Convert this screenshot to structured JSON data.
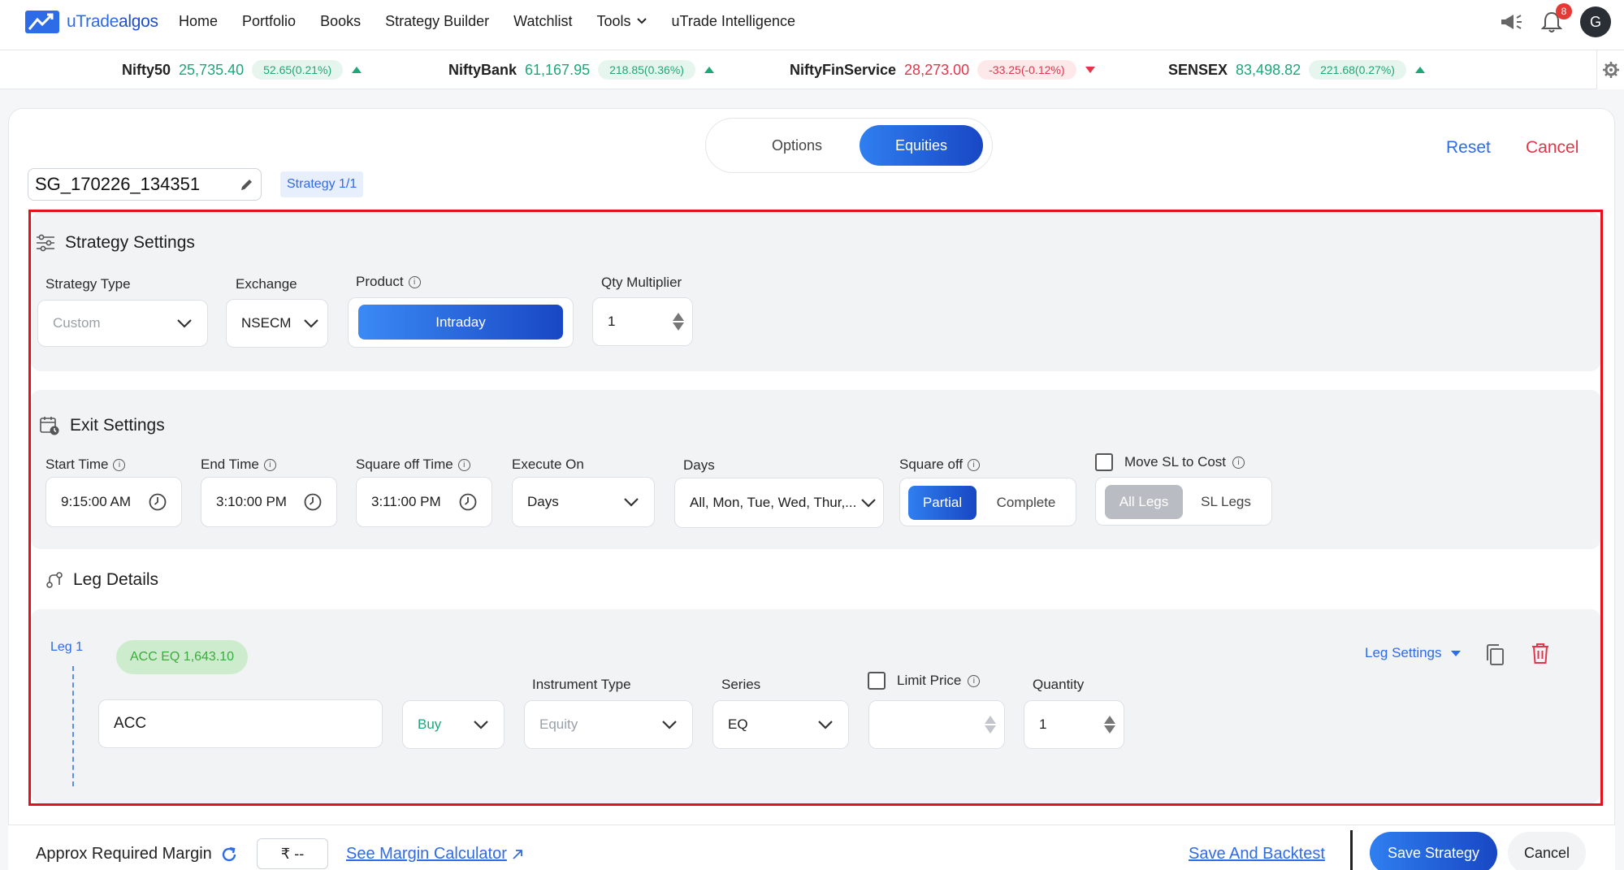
{
  "brand": {
    "name_part1": "uTrade",
    "name_part2": "algos"
  },
  "nav": {
    "items": [
      "Home",
      "Portfolio",
      "Books",
      "Strategy Builder",
      "Watchlist",
      "Tools",
      "uTrade Intelligence"
    ],
    "notification_count": "8",
    "avatar_initial": "G"
  },
  "ticker": [
    {
      "name": "Nifty50",
      "value": "25,735.40",
      "change": "52.65(0.21%)",
      "direction": "up"
    },
    {
      "name": "NiftyBank",
      "value": "61,167.95",
      "change": "218.85(0.36%)",
      "direction": "up"
    },
    {
      "name": "NiftyFinService",
      "value": "28,273.00",
      "change": "-33.25(-0.12%)",
      "direction": "down"
    },
    {
      "name": "SENSEX",
      "value": "83,498.82",
      "change": "221.68(0.27%)",
      "direction": "up"
    }
  ],
  "mode_toggle": {
    "options": [
      "Options",
      "Equities"
    ],
    "selected": "Equities"
  },
  "header_actions": {
    "reset": "Reset",
    "cancel": "Cancel"
  },
  "strategy_name": "SG_170226_134351",
  "strategy_badge": "Strategy 1/1",
  "strategy_settings": {
    "title": "Strategy Settings",
    "strategy_type": {
      "label": "Strategy Type",
      "value": "Custom"
    },
    "exchange": {
      "label": "Exchange",
      "value": "NSECM"
    },
    "product": {
      "label": "Product",
      "value": "Intraday"
    },
    "qty_multiplier": {
      "label": "Qty Multiplier",
      "value": "1"
    }
  },
  "exit_settings": {
    "title": "Exit Settings",
    "start_time": {
      "label": "Start Time",
      "value": "9:15:00 AM"
    },
    "end_time": {
      "label": "End Time",
      "value": "3:10:00 PM"
    },
    "square_off_time": {
      "label": "Square off Time",
      "value": "3:11:00 PM"
    },
    "execute_on": {
      "label": "Execute On",
      "value": "Days"
    },
    "days": {
      "label": "Days",
      "value": "All, Mon, Tue, Wed, Thur,..."
    },
    "square_off": {
      "label": "Square off",
      "options": [
        "Partial",
        "Complete"
      ],
      "selected": "Partial"
    },
    "move_sl": {
      "label": "Move SL to Cost",
      "checked": false,
      "options": [
        "All Legs",
        "SL Legs"
      ],
      "selected": "All Legs"
    }
  },
  "leg_details": {
    "title": "Leg Details",
    "leg": {
      "label": "Leg 1",
      "chip": "ACC EQ 1,643.10",
      "settings_label": "Leg Settings",
      "symbol": "ACC",
      "side": "Buy",
      "instrument_type": {
        "label": "Instrument Type",
        "value": "Equity"
      },
      "series": {
        "label": "Series",
        "value": "EQ"
      },
      "limit_price": {
        "label": "Limit Price",
        "checked": false,
        "value": ""
      },
      "quantity": {
        "label": "Quantity",
        "value": "1"
      }
    }
  },
  "footer": {
    "margin_label": "Approx Required Margin",
    "margin_value": "₹ --",
    "calc_link": "See Margin Calculator",
    "backtest": "Save And Backtest",
    "save": "Save Strategy",
    "cancel": "Cancel"
  },
  "colors": {
    "primary": "#2e6be6",
    "up": "#1fa67a",
    "down": "#e0364c",
    "frame": "#e5101e"
  }
}
